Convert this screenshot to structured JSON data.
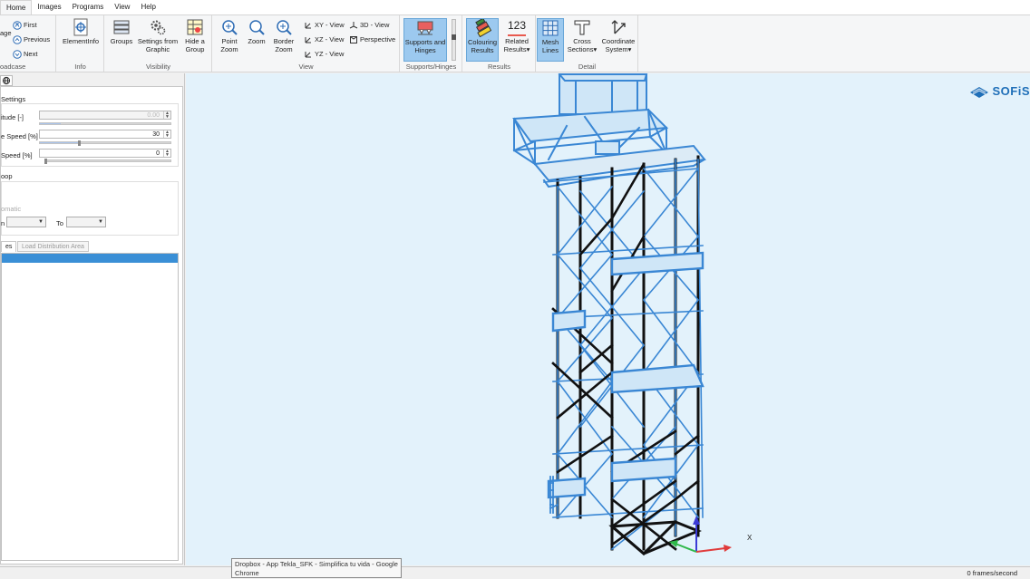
{
  "menu": {
    "items": [
      "Home",
      "Images",
      "Programs",
      "View",
      "Help"
    ],
    "active_index": 0
  },
  "ribbon": {
    "loadcase": {
      "label": "oadcase",
      "partial_button": "age",
      "first": "First",
      "previous": "Previous",
      "next": "Next"
    },
    "info": {
      "label": "Info",
      "element_info": "ElementInfo"
    },
    "visibility": {
      "label": "Visibility",
      "groups": "Groups",
      "settings_from_graphic_1": "Settings from",
      "settings_from_graphic_2": "Graphic",
      "hide_group_1": "Hide a",
      "hide_group_2": "Group"
    },
    "view": {
      "label": "View",
      "point_zoom_1": "Point",
      "point_zoom_2": "Zoom",
      "zoom": "Zoom",
      "border_zoom_1": "Border",
      "border_zoom_2": "Zoom",
      "xy_view": "XY - View",
      "xz_view": "XZ - View",
      "yz_view": "YZ - View",
      "view_3d": "3D - View",
      "perspective": "Perspective"
    },
    "supports": {
      "label": "Supports/Hinges",
      "btn_1": "Supports and",
      "btn_2": "Hinges"
    },
    "results": {
      "label": "Results",
      "colouring_1": "Colouring",
      "colouring_2": "Results",
      "related_icon_text": "123",
      "related_1": "Related",
      "related_2": "Results"
    },
    "detail": {
      "label": "Detail",
      "mesh_1": "Mesh",
      "mesh_2": "Lines",
      "cross_1": "Cross",
      "cross_2": "Sections",
      "coord_1": "Coordinate",
      "coord_2": "System"
    }
  },
  "left_panel": {
    "settings_title": "Settings",
    "amplitude_label": "itude [-]",
    "amplitude_value": "0.00",
    "speed_label": "e Speed [%]",
    "speed_value": "30",
    "speed_fraction": 0.3,
    "rot_speed_label": "Speed [%]",
    "rot_speed_value": "0",
    "rot_speed_fraction": 0.0,
    "loop_title": "oop",
    "automatic_label": "omatic",
    "from_label": "n",
    "to_label": "To",
    "tabs": [
      "es",
      "Load Distribution Area"
    ]
  },
  "viewport": {
    "logo_text": "SOFiS",
    "axis_x": "X"
  },
  "tooltip": {
    "line1": "Dropbox - App Tekla_SFK - Simplifica tu vida - Google",
    "line2": "Chrome"
  },
  "status": {
    "fps": "0 frames/second"
  },
  "colors": {
    "accent": "#1f6fb8",
    "viewport_bg": "#e3f2fb",
    "selected_button": "#9cc9ef",
    "structure_blue": "#3a87d4",
    "structure_black": "#111111"
  }
}
